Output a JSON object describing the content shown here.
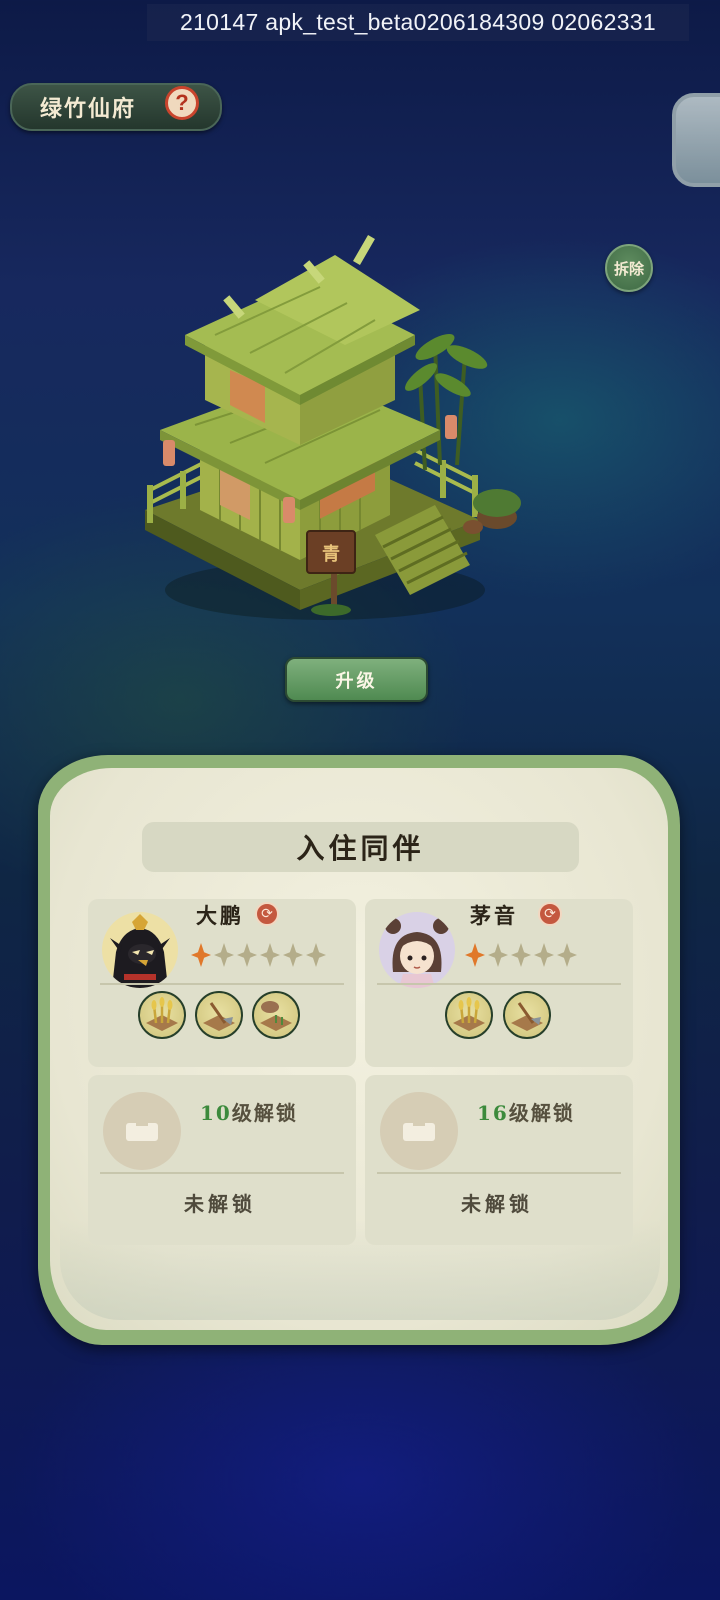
{
  "debug": {
    "build_text": "210147  apk_test_beta0206184309  02062331"
  },
  "building": {
    "title": "绿竹仙府",
    "help_icon_glyph": "?",
    "demolish_label": "拆除",
    "sign_char": "青",
    "upgrade_label": "升级"
  },
  "panel": {
    "title": "入住同伴",
    "companions": [
      {
        "name": "大鹏",
        "stars_filled": 1,
        "stars_total": 6,
        "skills": [
          "harvest-icon",
          "hoe-icon",
          "watering-icon"
        ]
      },
      {
        "name": "茅音",
        "stars_filled": 1,
        "stars_total": 5,
        "skills": [
          "harvest-icon",
          "hoe-icon"
        ]
      }
    ],
    "locked_slots": [
      {
        "level_num": "10",
        "level_suffix": "级解锁",
        "status": "未解锁"
      },
      {
        "level_num": "16",
        "level_suffix": "级解锁",
        "status": "未解锁"
      }
    ]
  },
  "colors": {
    "accent_green": "#4f8a51",
    "star_filled": "#e0782a",
    "star_empty": "#b4ad8a",
    "swap_red": "#c4583f",
    "unlock_level_green": "#3c8a3c"
  }
}
